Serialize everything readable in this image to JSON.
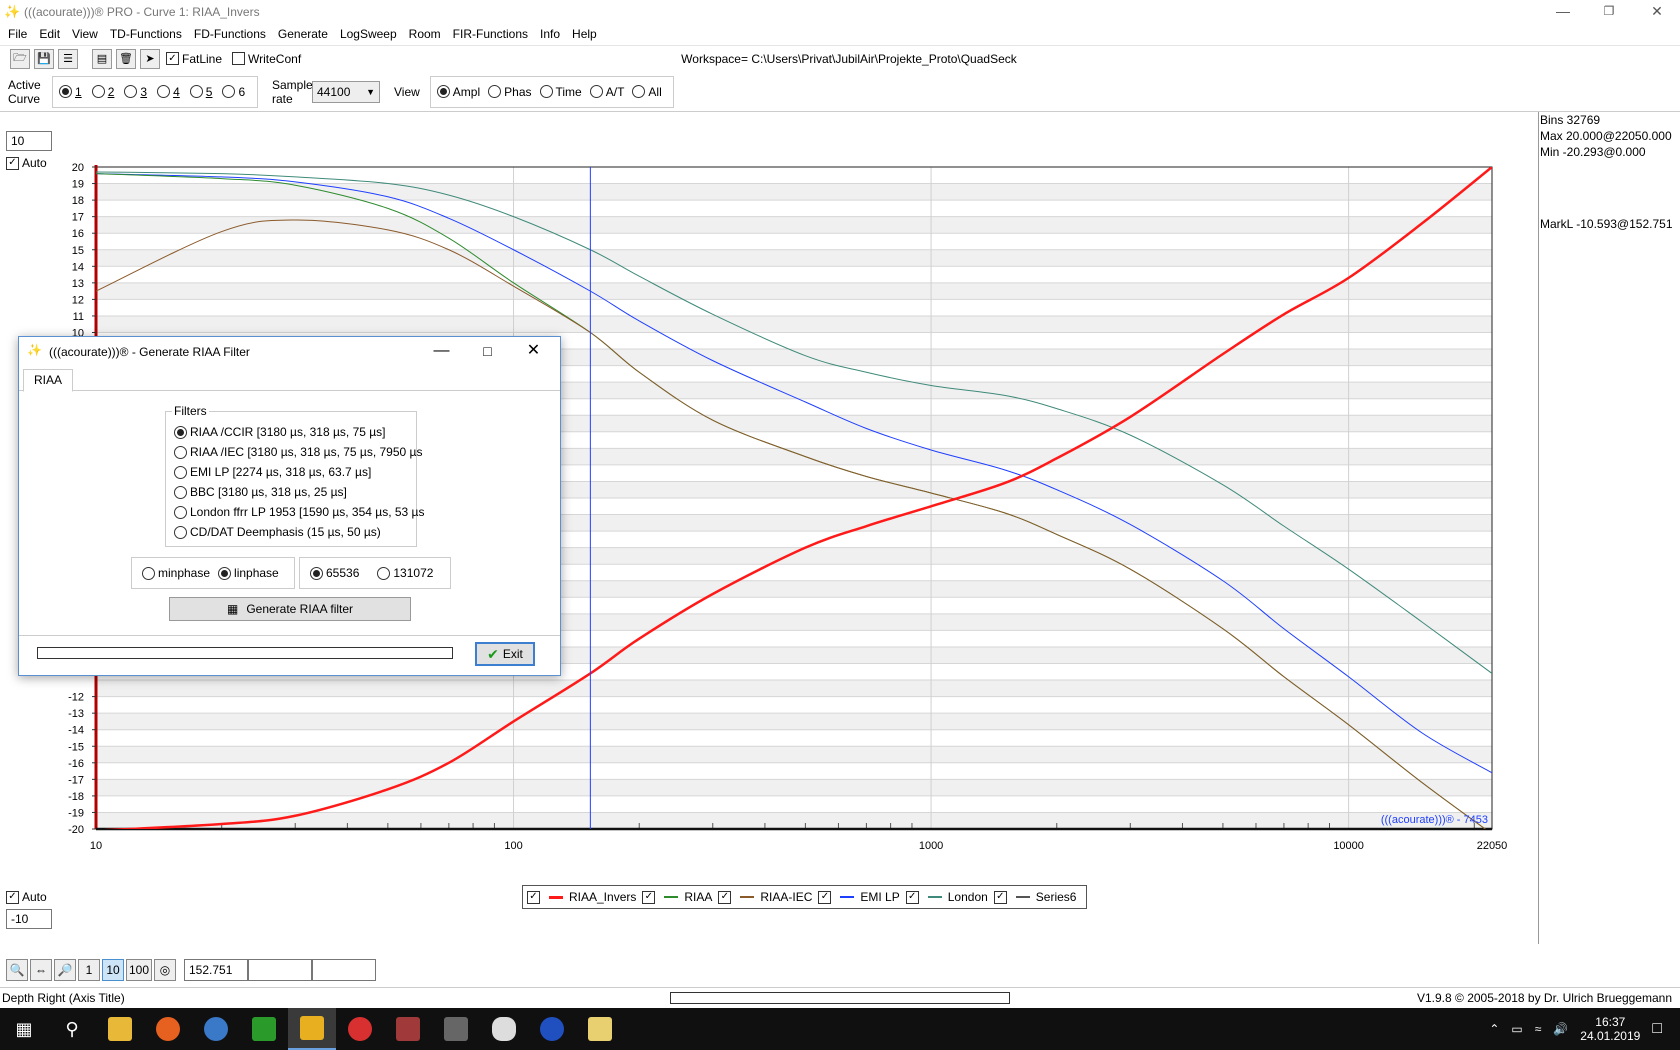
{
  "window": {
    "title": "(((acourate)))® PRO - Curve 1: RIAA_Invers",
    "minimize": "—",
    "restore": "❐",
    "close": "✕"
  },
  "menu": [
    "File",
    "Edit",
    "View",
    "TD-Functions",
    "FD-Functions",
    "Generate",
    "LogSweep",
    "Room",
    "FIR-Functions",
    "Info",
    "Help"
  ],
  "toolbar": {
    "fatline": "FatLine",
    "fatline_checked": true,
    "writeconf": "WriteConf",
    "writeconf_checked": false,
    "workspace": "Workspace= C:\\Users\\Privat\\JubilAir\\Projekte_Proto\\QuadSeck"
  },
  "curvebar": {
    "active_curve_label": "Active Curve",
    "curves": [
      "1",
      "2",
      "3",
      "4",
      "5",
      "6"
    ],
    "active_index": 0,
    "sample_rate_label": "Sample rate",
    "sample_rate": "44100",
    "view_label": "View",
    "views": [
      "Ampl",
      "Phas",
      "Time",
      "A/T",
      "All"
    ],
    "view_active": 0
  },
  "axis_controls": {
    "top_value": "10",
    "top_auto": "Auto",
    "bottom_auto": "Auto",
    "bottom_value": "-10"
  },
  "info": {
    "bins": "Bins 32769",
    "max": "Max 20.000@22050.000",
    "min": "Min -20.293@0.000",
    "markl": "MarkL -10.593@152.751"
  },
  "chart_data": {
    "type": "line",
    "xscale": "log",
    "xlim": [
      10,
      22050
    ],
    "ylim": [
      -20,
      20
    ],
    "yticks": [
      20,
      19,
      18,
      17,
      16,
      15,
      14,
      13,
      12,
      11,
      10,
      -12,
      -13,
      -14,
      -15,
      -16,
      -17,
      -18,
      -19,
      -20
    ],
    "xticks": [
      "10",
      "100",
      "1000",
      "10000",
      "22050"
    ],
    "watermark": "(((acourate)))® - 7453",
    "marker_x": 152.751,
    "series": [
      {
        "name": "RIAA_Invers",
        "color": "#ff1a1a",
        "width": 2.5,
        "x": [
          10,
          20,
          30,
          50,
          70,
          100,
          152.751,
          200,
          300,
          500,
          700,
          1000,
          1500,
          2000,
          3000,
          5000,
          7000,
          10000,
          15000,
          22050
        ],
        "y": [
          -20.1,
          -19.7,
          -19.2,
          -17.6,
          -16.0,
          -13.5,
          -10.6,
          -8.5,
          -5.8,
          -3.0,
          -1.7,
          -0.5,
          0.9,
          2.4,
          4.9,
          8.7,
          11.1,
          13.3,
          16.6,
          20.0
        ]
      },
      {
        "name": "RIAA",
        "color": "#2e8b2e",
        "width": 1,
        "x": [
          10,
          20,
          30,
          50,
          70,
          100,
          152.751,
          200,
          300,
          500,
          700,
          1000,
          1500,
          2000,
          3000,
          5000,
          7000,
          10000,
          15000,
          22050
        ],
        "y": [
          19.6,
          19.3,
          18.9,
          17.5,
          15.7,
          13.0,
          10.0,
          7.6,
          4.7,
          2.5,
          1.3,
          0.3,
          -0.9,
          -2.2,
          -4.3,
          -7.9,
          -10.8,
          -13.7,
          -17.2,
          -20.3
        ]
      },
      {
        "name": "RIAA-IEC",
        "color": "#8b5a2b",
        "width": 1,
        "x": [
          10,
          20,
          30,
          50,
          70,
          100,
          152.751,
          200,
          300,
          500,
          700,
          1000,
          1500,
          2000,
          3000,
          5000,
          7000,
          10000,
          15000,
          22050
        ],
        "y": [
          12.5,
          16.1,
          16.8,
          16.2,
          15.0,
          12.8,
          10.0,
          7.6,
          4.7,
          2.5,
          1.3,
          0.3,
          -0.9,
          -2.2,
          -4.3,
          -7.9,
          -10.8,
          -13.7,
          -17.2,
          -20.3
        ]
      },
      {
        "name": "EMI LP",
        "color": "#1f3fff",
        "width": 1,
        "x": [
          10,
          20,
          30,
          50,
          70,
          100,
          152.751,
          200,
          300,
          500,
          700,
          1000,
          1500,
          2000,
          3000,
          5000,
          7000,
          10000,
          15000,
          22050
        ],
        "y": [
          19.6,
          19.4,
          19.1,
          18.2,
          16.9,
          15.0,
          12.5,
          10.7,
          8.3,
          5.8,
          4.2,
          2.9,
          1.7,
          0.5,
          -1.6,
          -5.0,
          -7.9,
          -10.8,
          -14.2,
          -16.6
        ]
      },
      {
        "name": "London",
        "color": "#3f8a7a",
        "width": 1,
        "x": [
          10,
          20,
          30,
          50,
          70,
          100,
          152.751,
          200,
          300,
          500,
          700,
          1000,
          1500,
          2000,
          3000,
          5000,
          7000,
          10000,
          15000,
          22050
        ],
        "y": [
          19.7,
          19.6,
          19.4,
          19.0,
          18.3,
          17.0,
          15.0,
          13.4,
          11.1,
          8.6,
          7.6,
          6.8,
          6.2,
          5.4,
          3.8,
          0.8,
          -1.7,
          -4.3,
          -7.5,
          -10.6
        ]
      },
      {
        "name": "Series6",
        "color": "#555555",
        "width": 1,
        "x": [],
        "y": []
      }
    ]
  },
  "legend_checked": [
    true,
    true,
    true,
    true,
    true,
    true
  ],
  "dialog": {
    "title": "(((acourate)))® - Generate RIAA Filter",
    "tab": "RIAA",
    "filters_label": "Filters",
    "filters": [
      "RIAA /CCIR [3180 µs, 318 µs, 75 µs]",
      "RIAA /IEC [3180 µs, 318 µs, 75 µs, 7950 µs",
      "EMI LP [2274 µs, 318 µs, 63.7 µs]",
      "BBC [3180 µs, 318 µs, 25 µs]",
      "London ffrr LP 1953 [1590 µs, 354 µs, 53 µs",
      "CD/DAT Deemphasis (15 µs, 50 µs)"
    ],
    "filter_selected": 0,
    "phase_min": "minphase",
    "phase_lin": "linphase",
    "phase_selected": "lin",
    "size_a": "65536",
    "size_b": "131072",
    "size_selected": "a",
    "generate_button": "Generate RIAA filter",
    "exit_button": "Exit"
  },
  "bottom": {
    "zoom_levels": [
      "1",
      "10",
      "100"
    ],
    "zoom_active": 1,
    "field1": "152.751",
    "field2": "",
    "field3": ""
  },
  "status": {
    "left": "Depth Right (Axis Title)",
    "right": "V1.9.8 © 2005-2018 by Dr. Ulrich Brueggemann"
  },
  "taskbar": {
    "time": "16:37",
    "date": "24.01.2019"
  }
}
